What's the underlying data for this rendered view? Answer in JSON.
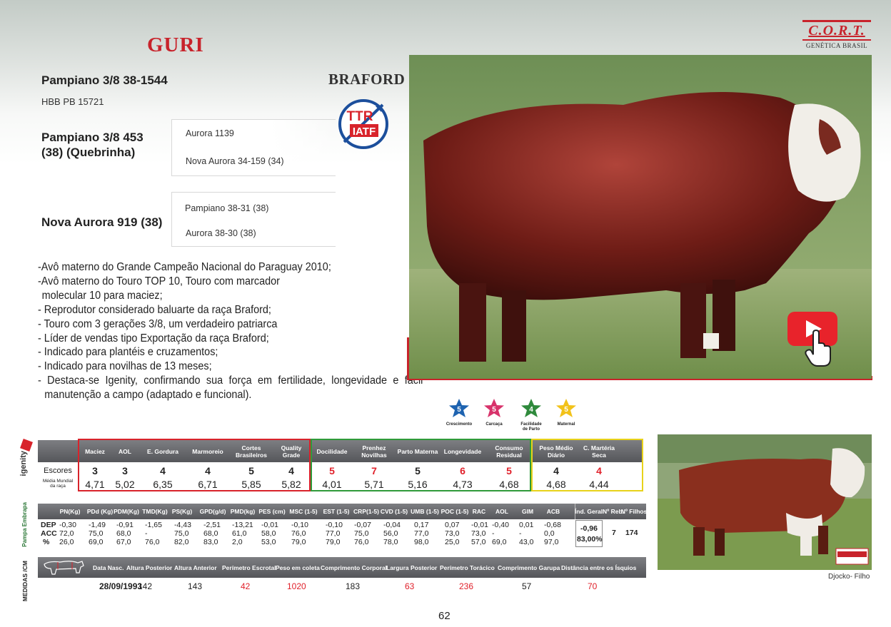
{
  "header": {
    "title": "GURI",
    "logo_main": "C.O.R.T.",
    "logo_sub": "GENÉTICA BRASIL"
  },
  "animal": {
    "sire_name": "Pampiano 3/8 38-1544",
    "breed": "BRAFORD",
    "registration": "HBB PB 15721",
    "badge_top": "TTR",
    "badge_bottom": "IATF"
  },
  "pedigree": {
    "sire": {
      "name": "Pampiano 3/8 453\n(38) (Quebrinha)",
      "line1": "Aurora 1139",
      "line2": "Nova Aurora 34-159 (34)"
    },
    "dam": {
      "name": "Nova Aurora 919 (38)",
      "line1": "Pampiano 38-31 (38)",
      "line2": "Aurora 38-30 (38)"
    }
  },
  "notes": [
    "-Avô materno do Grande Campeão Nacional do Paraguay 2010;",
    "-Avô materno do Touro TOP 10, Touro com marcador",
    "  molecular 10 para maciez;",
    "- Reprodutor considerado baluarte da raça Braford;",
    "- Touro com 3 gerações 3/8, um verdadeiro patriarca",
    "- Líder de vendas tipo Exportação da raça Braford;",
    "- Indicado para plantéis e cruzamentos;",
    "- Indicado para novilhas de 13 meses;",
    "- Destaca-se Igenity, confirmando sua força em fertilidade, longevidade e fácil manutenção a campo (adaptado e funcional)."
  ],
  "stars": [
    {
      "value": "5",
      "label": "Crescimento",
      "color": "#1e63b0"
    },
    {
      "value": "5",
      "label": "Carcaça",
      "color": "#d8336b"
    },
    {
      "value": "4",
      "label": "Facilidade de Parto",
      "color": "#2f8a3c"
    },
    {
      "value": "5",
      "label": "Maternal",
      "color": "#f2c21a"
    }
  ],
  "igenity": {
    "side_label": "igenity",
    "headers": [
      "Maciez",
      "AOL",
      "E. Gordura",
      "Marmoreio",
      "Cortes Brasileiros",
      "Quality Grade",
      "Docilidade",
      "Prenhez Novilhas",
      "Parto Materna",
      "Longevidade",
      "Consumo Residual",
      "Peso Médio Diário",
      "C. Martéria Seca"
    ],
    "row1_label": "Escores",
    "row2_label": "Média Mundial da raça",
    "scores": [
      "3",
      "3",
      "4",
      "4",
      "5",
      "4",
      "5",
      "7",
      "5",
      "6",
      "5",
      "4",
      "4"
    ],
    "world_avg": [
      "4,71",
      "5,02",
      "6,35",
      "6,71",
      "5,85",
      "5,82",
      "4,01",
      "5,71",
      "5,16",
      "4,73",
      "4,68",
      "4,68",
      "4,44"
    ],
    "frame_colors": [
      "#d8232b",
      "#2f9a3a",
      "#e8d21a"
    ]
  },
  "dep": {
    "side_label": "Pampa Embrapa",
    "headers": [
      "PN(Kg)",
      "PDd (Kg)",
      "PDM(Kg)",
      "TMD(Kg)",
      "PS(Kg)",
      "GPD(g/d)",
      "PMD(kg)",
      "PES (cm)",
      "MSC (1-5)",
      "EST (1-5)",
      "CRP(1-5)",
      "CVD (1-5)",
      "UMB (1-5)",
      "POC (1-5)",
      "RAC",
      "AOL",
      "GIM",
      "ACB",
      "Índ. Geral",
      "Nº Reb.",
      "Nº Filhos"
    ],
    "row_labels": [
      "DEP",
      "ACC",
      "%"
    ],
    "dep_row": [
      "-0,30",
      "-1,49",
      "-0,91",
      "-1,65",
      "-4,43",
      "-2,51",
      "-13,21",
      "-0,01",
      "-0,10",
      "-0,10",
      "-0,07",
      "-0,04",
      "0,17",
      "0,07",
      "-0,01",
      "-0,40",
      "0,01",
      "-0,68"
    ],
    "acc_row": [
      "72,0",
      "75,0",
      "68,0",
      "-",
      "75,0",
      "68,0",
      "61,0",
      "58,0",
      "76,0",
      "77,0",
      "75,0",
      "56,0",
      "77,0",
      "73,0",
      "73,0",
      "-",
      "-",
      "0,0"
    ],
    "pct_row": [
      "26,0",
      "69,0",
      "67,0",
      "76,0",
      "82,0",
      "83,0",
      "2,0",
      "53,0",
      "79,0",
      "79,0",
      "76,0",
      "78,0",
      "98,0",
      "25,0",
      "57,0",
      "69,0",
      "43,0",
      "97,0"
    ],
    "ind_geral": "-0,96",
    "ind_geral_pct": "83,00%",
    "n_reb": "7",
    "n_filhos": "174"
  },
  "measures": {
    "side_label": "MEDIDAS /CM",
    "headers": [
      "Data  Nasc.",
      "Altura Posterior",
      "Altura Anterior",
      "Perímetro Escrotal",
      "Peso em coleta",
      "Comprimento Corporal",
      "Largura Posterior",
      "Perímetro Torácico",
      "Comprimento Garupa",
      "Distância entre os Ísquios"
    ],
    "values": [
      "28/09/1993",
      "142",
      "143",
      "42",
      "1020",
      "183",
      "63",
      "236",
      "57",
      "70"
    ]
  },
  "photo_caption": "Djocko- Filho",
  "page_number": "62"
}
